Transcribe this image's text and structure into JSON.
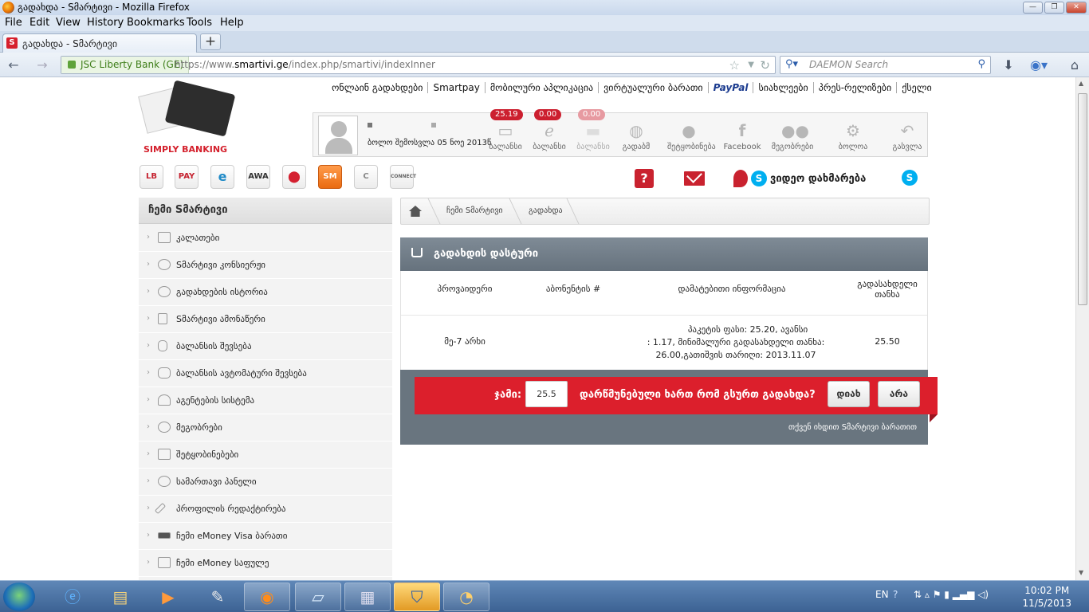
{
  "window": {
    "title": "გადახდა - Sმარტივი - Mozilla Firefox"
  },
  "menu": [
    "File",
    "Edit",
    "View",
    "History",
    "Bookmarks",
    "Tools",
    "Help"
  ],
  "tab": {
    "label": "გადახდა - Sმარტივი"
  },
  "navbar": {
    "identity": "JSC Liberty Bank (GE)",
    "url_prefix": "https://www.",
    "url_domain": "smartivi.ge",
    "url_path": "/index.php/smartivi/indexInner",
    "search_placeholder": "DAEMON Search"
  },
  "site": {
    "logo_text": "SIMPLY BANKING",
    "topnav": [
      "ონლაინ გადახდები",
      "Smartpay",
      "მობილური აპლიკაცია",
      "ვირტუალური ბარათი",
      "PayPal",
      "სიახლეები",
      "პრეს-რელიზები",
      "ქსელი"
    ],
    "last_login": "ბოლო შემოსვლა 05 ნოე 2013წ",
    "profile_items": [
      {
        "label": "ბალანსი",
        "badge": "25.19",
        "icon": "wallet-icon"
      },
      {
        "label": "ბალანსი",
        "badge": "0.00",
        "icon": "emoney-icon"
      },
      {
        "label": "ბალანსი",
        "badge": "0.00",
        "icon": "card-icon"
      },
      {
        "label": "გადაბმ",
        "icon": "globe-icon"
      },
      {
        "label": "შეტყობინება",
        "icon": "chat-icon"
      },
      {
        "label": "Facebook",
        "icon": "facebook-icon"
      },
      {
        "label": "მეგობრები",
        "icon": "friends-icon"
      },
      {
        "label": "ბოლოა",
        "icon": "gear-icon"
      },
      {
        "label": "გასვლა",
        "icon": "logout-icon"
      }
    ],
    "app_icons": [
      "LB",
      "PAY",
      "e",
      "AWA",
      "map",
      "SM",
      "C",
      "CONNECT"
    ],
    "video_help": "ვიდეო დახმარება"
  },
  "sidebar": {
    "title": "ჩემი Sმარტივი",
    "items": [
      {
        "label": "კალათები",
        "icon": "cart-icon"
      },
      {
        "label": "Sმარტივი კონსიერჟი",
        "icon": "heart-icon"
      },
      {
        "label": "გადახდების ისტორია",
        "icon": "history-icon"
      },
      {
        "label": "Sმარტივი ამონაწერი",
        "icon": "document-icon"
      },
      {
        "label": "ბალანსის შევსება",
        "icon": "coins-icon"
      },
      {
        "label": "ბალანსის ავტომატური შევსება",
        "icon": "auto-coins-icon"
      },
      {
        "label": "აგენტების სისტემა",
        "icon": "agents-icon"
      },
      {
        "label": "მეგობრები",
        "icon": "friends-icon"
      },
      {
        "label": "შეტყობინებები",
        "icon": "messages-icon"
      },
      {
        "label": "სამართავი პანელი",
        "icon": "settings-icon"
      },
      {
        "label": "პროფილის რედაქტირება",
        "icon": "wrench-icon"
      },
      {
        "label": "ჩემი eMoney Visa ბარათი",
        "icon": "visa-card-icon"
      },
      {
        "label": "ჩემი eMoney საფულე",
        "icon": "wallet-icon"
      }
    ]
  },
  "breadcrumb": [
    "ჩემი Sმარტივი",
    "გადახდა"
  ],
  "payment": {
    "title": "გადახდის დასტური",
    "columns": [
      "პროვაიდერი",
      "აბონენტის #",
      "დამატებითი ინფორმაცია",
      "გადასახდელი თანხა"
    ],
    "row": {
      "provider": "მე-7 არხი",
      "subscriber": "",
      "info_line1": "პაკეტის ფასი: 25.20, ავანსი",
      "info_line2": ": 1.17, მინიმალური გადასახდელი თანხა:",
      "info_line3": "26.00,გათიშვის თარიღი: 2013.11.07",
      "amount": "25.50"
    },
    "sum_label": "ჯამი:",
    "sum_value": "25.5",
    "question": "დარწმუნებული ხართ რომ გსურთ გადახდა?",
    "yes_label": "დიახ",
    "no_label": "არა",
    "hint": "თქვენ იხდით Sმარტივი ბარათით"
  },
  "taskbar": {
    "lang": "EN",
    "time": "10:02 PM",
    "date": "11/5/2013"
  },
  "colors": {
    "brand_red": "#dc1f2c",
    "panel_grey": "#69757f"
  }
}
